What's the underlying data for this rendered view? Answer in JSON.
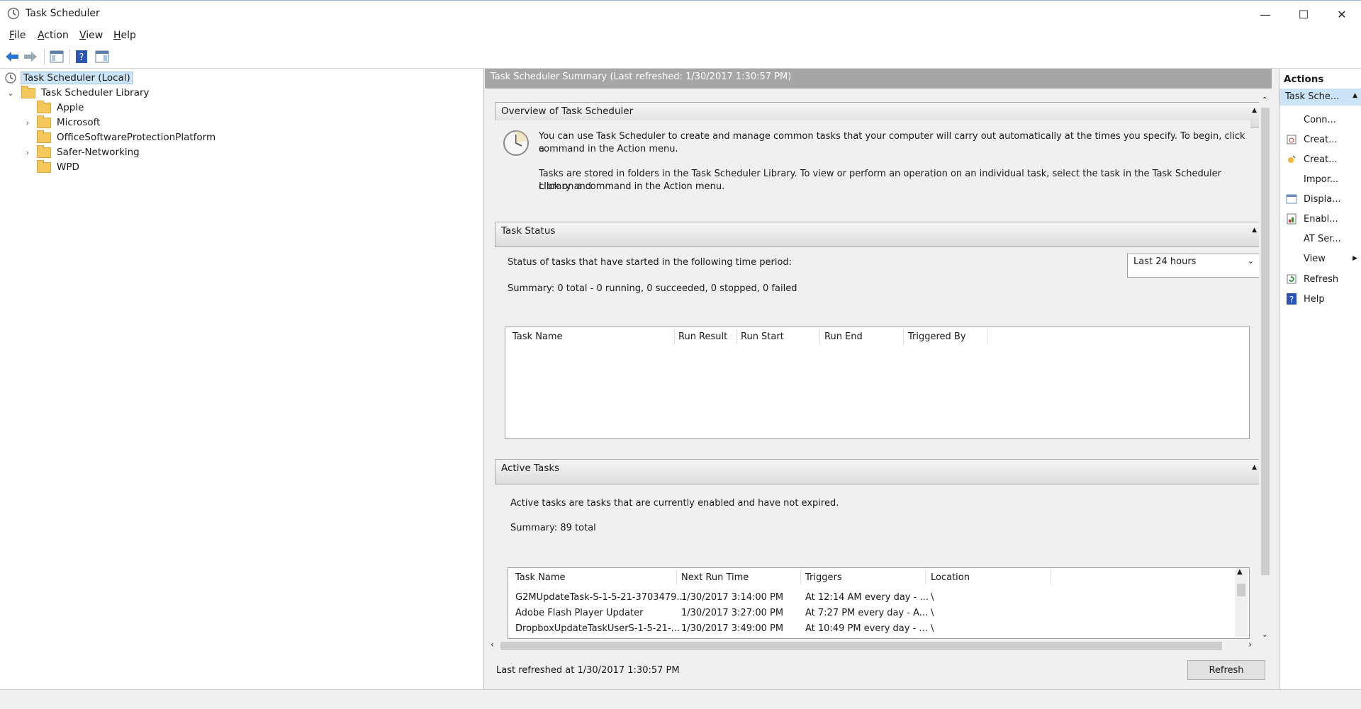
{
  "window": {
    "title": "Task Scheduler",
    "minimize": "—",
    "maximize": "☐",
    "close": "✕"
  },
  "menu": [
    {
      "label": "File",
      "key": "F",
      "rest": "ile"
    },
    {
      "label": "Action",
      "key": "A",
      "rest": "ction"
    },
    {
      "label": "View",
      "key": "V",
      "rest": "iew"
    },
    {
      "label": "Help",
      "key": "H",
      "rest": "elp"
    }
  ],
  "tree": {
    "root": "Task Scheduler (Local)",
    "library": "Task Scheduler Library",
    "folders": [
      "Apple",
      "Microsoft",
      "OfficeSoftwareProtectionPlatform",
      "Safer-Networking",
      "WPD"
    ]
  },
  "center": {
    "header": "Task Scheduler Summary (Last refreshed: 1/30/2017 1:30:57 PM)",
    "overview": {
      "title": "Overview of Task Scheduler",
      "line1": "You can use Task Scheduler to create and manage common tasks that your computer will carry out automatically at the times you specify. To begin, click a",
      "line2": "command in the Action menu.",
      "line3": "Tasks are stored in folders in the Task Scheduler Library. To view or perform an operation on an individual task, select the task in the Task Scheduler Library and",
      "line4": "click on a command in the Action menu."
    },
    "task_status": {
      "title": "Task Status",
      "period_label": "Status of tasks that have started in the following time period:",
      "period_value": "Last 24 hours",
      "summary": "Summary: 0 total - 0 running, 0 succeeded, 0 stopped, 0 failed",
      "columns": [
        "Task Name",
        "Run Result",
        "Run Start",
        "Run End",
        "Triggered By"
      ]
    },
    "active_tasks": {
      "title": "Active Tasks",
      "desc": "Active tasks are tasks that are currently enabled and have not expired.",
      "summary": "Summary: 89 total",
      "columns": [
        "Task Name",
        "Next Run Time",
        "Triggers",
        "Location"
      ],
      "rows": [
        {
          "name": "G2MUpdateTask-S-1-5-21-3703479...",
          "next": "1/30/2017 3:14:00 PM",
          "triggers": "At 12:14 AM every day - ...",
          "location": "\\"
        },
        {
          "name": "Adobe Flash Player Updater",
          "next": "1/30/2017 3:27:00 PM",
          "triggers": "At 7:27 PM every day - A...",
          "location": "\\"
        },
        {
          "name": "DropboxUpdateTaskUserS-1-5-21-...",
          "next": "1/30/2017 3:49:00 PM",
          "triggers": "At 10:49 PM every day - ...",
          "location": "\\"
        }
      ]
    },
    "last_refreshed": "Last refreshed at 1/30/2017 1:30:57 PM",
    "refresh_button": "Refresh"
  },
  "actions": {
    "title": "Actions",
    "group": "Task Sche...",
    "items": [
      {
        "label": "Conn...",
        "icon": "none"
      },
      {
        "label": "Creat...",
        "icon": "create-basic-task-icon"
      },
      {
        "label": "Creat...",
        "icon": "create-task-icon"
      },
      {
        "label": "Impor...",
        "icon": "none"
      },
      {
        "label": "Displa...",
        "icon": "display-running-icon"
      },
      {
        "label": "Enabl...",
        "icon": "enable-history-icon"
      },
      {
        "label": "AT Ser...",
        "icon": "none"
      },
      {
        "label": "View",
        "icon": "none"
      },
      {
        "label": "Refresh",
        "icon": "refresh-icon"
      },
      {
        "label": "Help",
        "icon": "help-icon"
      }
    ]
  }
}
